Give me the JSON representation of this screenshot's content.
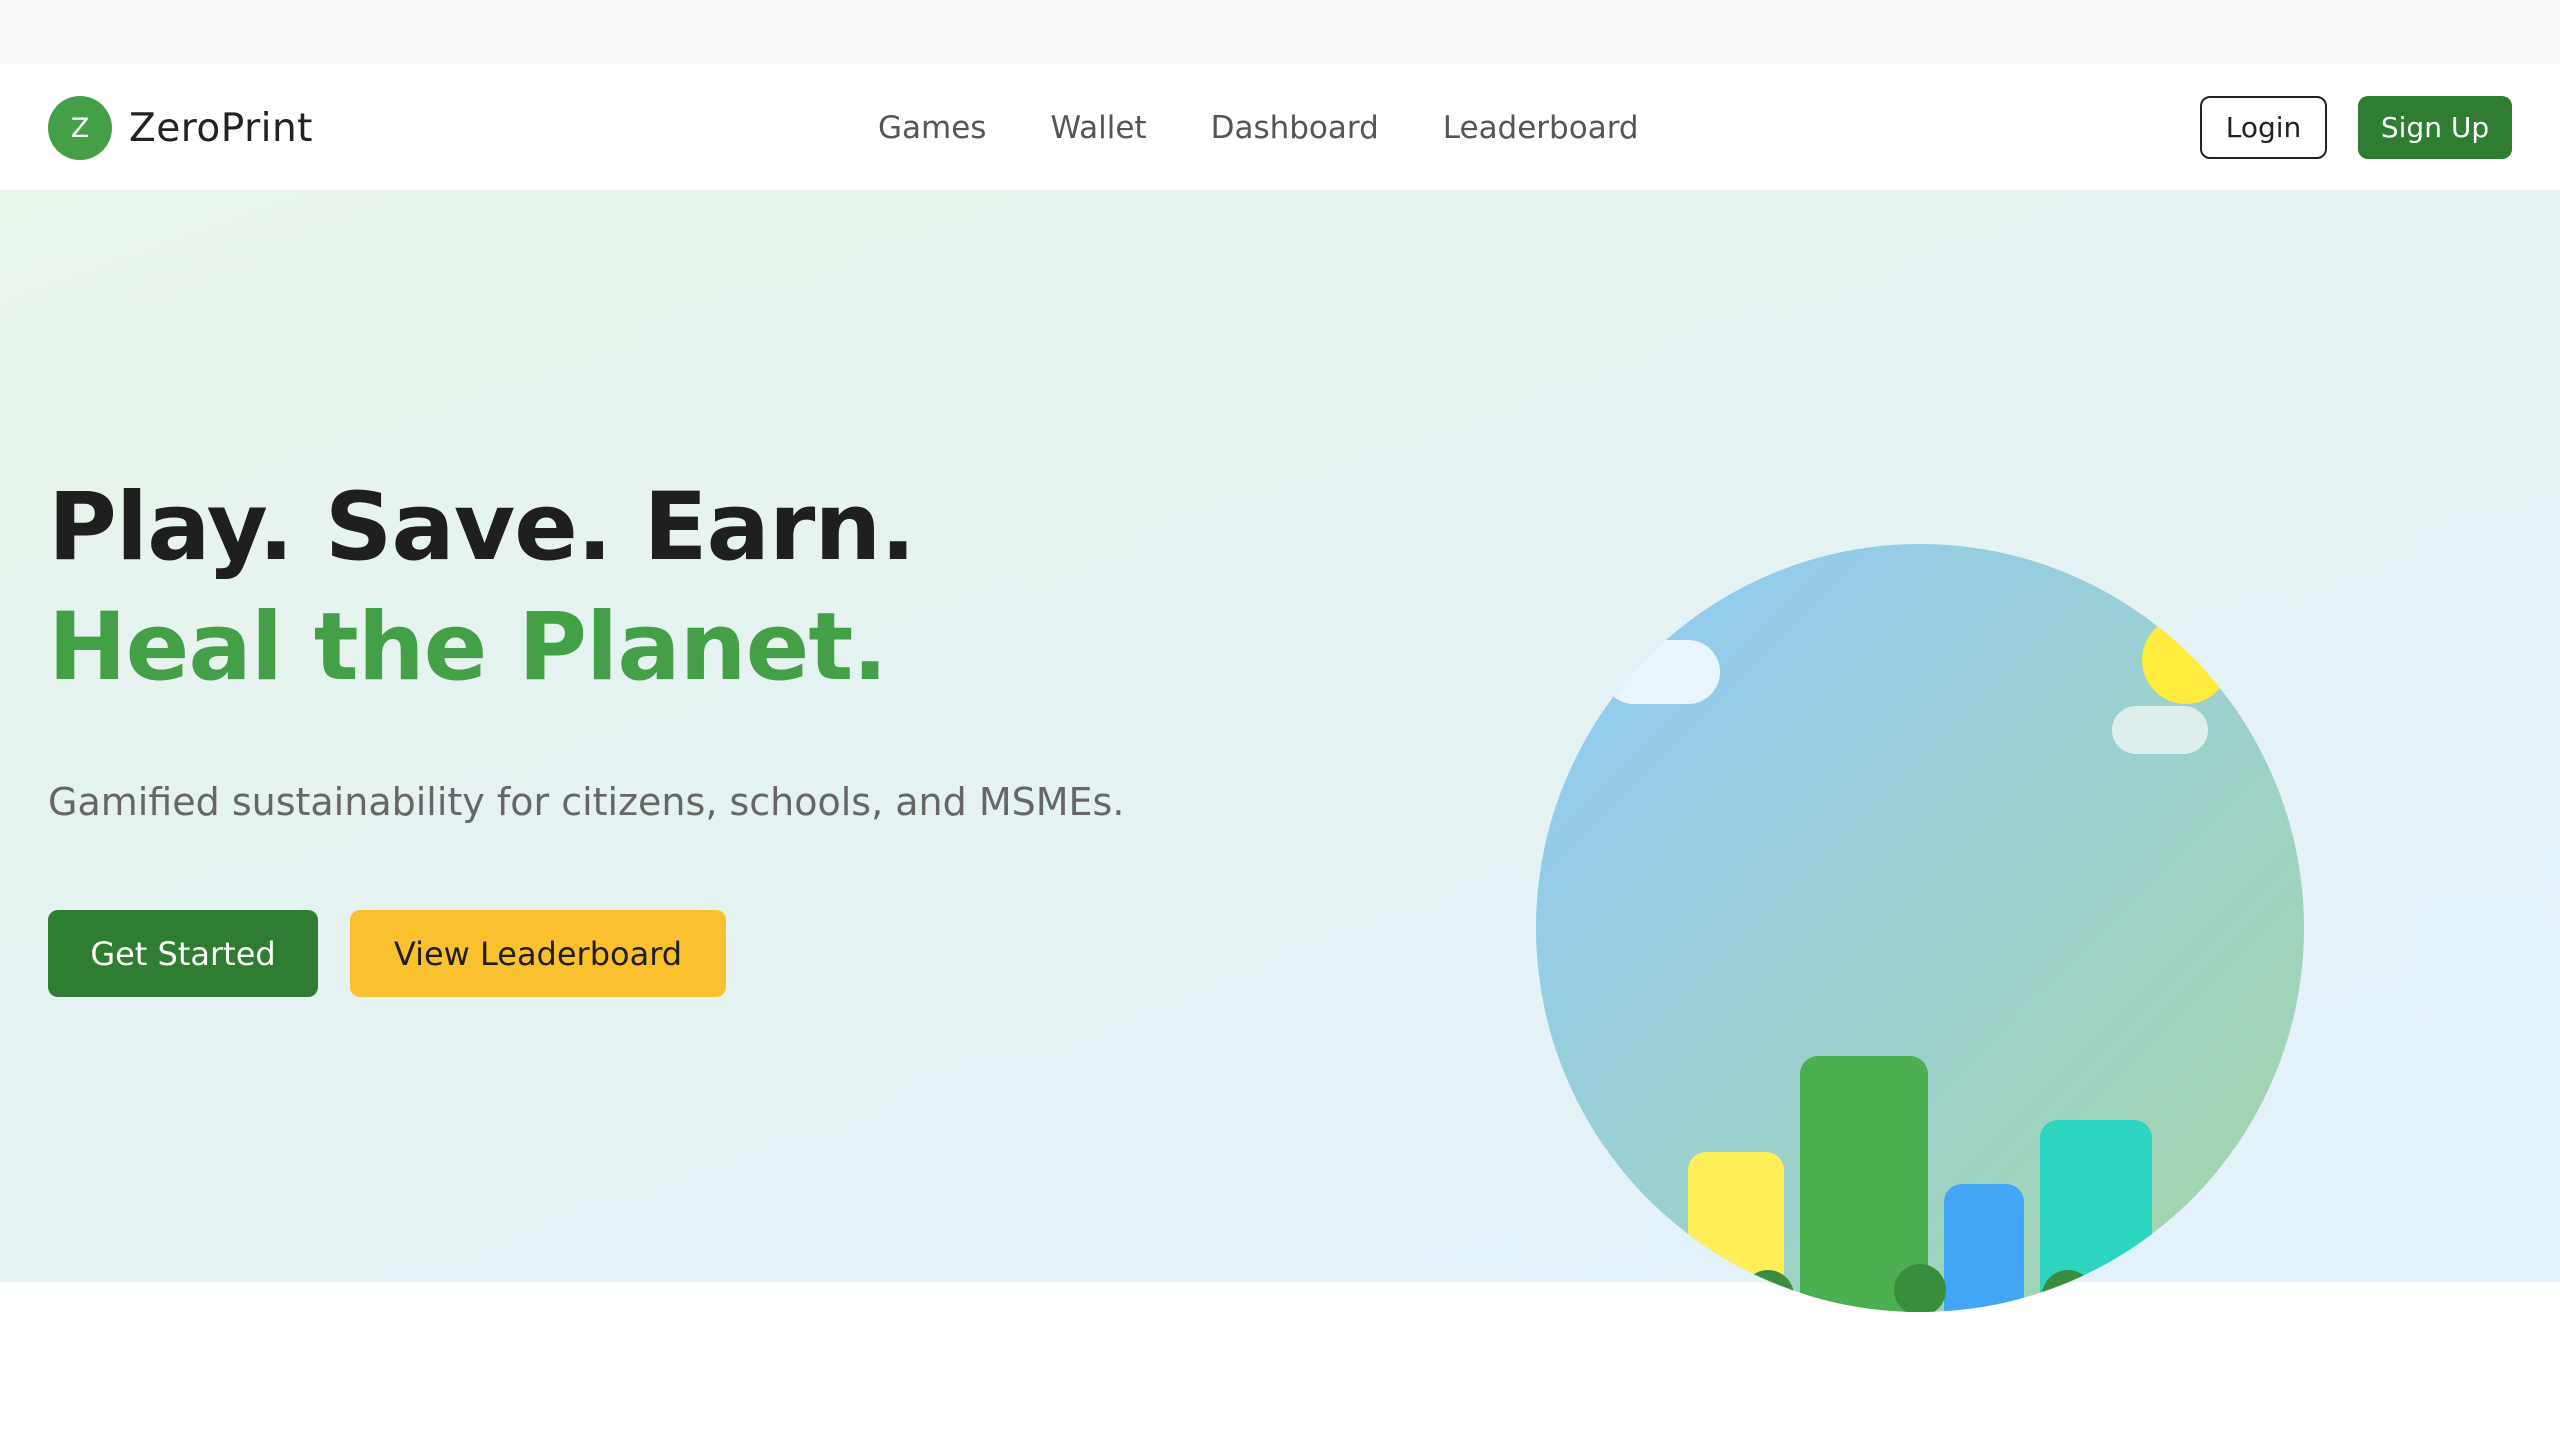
{
  "brand": {
    "logo_letter": "Z",
    "name": "ZeroPrint"
  },
  "nav": {
    "items": [
      {
        "label": "Games"
      },
      {
        "label": "Wallet"
      },
      {
        "label": "Dashboard"
      },
      {
        "label": "Leaderboard"
      }
    ]
  },
  "auth": {
    "login_label": "Login",
    "signup_label": "Sign Up"
  },
  "hero": {
    "headline_line1": "Play. Save. Earn.",
    "headline_line2": "Heal the Planet.",
    "subtitle": "Gamified sustainability for citizens, schools, and MSMEs.",
    "primary_cta": "Get Started",
    "secondary_cta": "View Leaderboard"
  },
  "colors": {
    "brand_green": "#43a047",
    "dark_green": "#2e7d32",
    "accent_yellow": "#fbc02d",
    "text_dark": "#1f1f1f"
  },
  "icons": {
    "illustration": "city-planet-illustration"
  }
}
